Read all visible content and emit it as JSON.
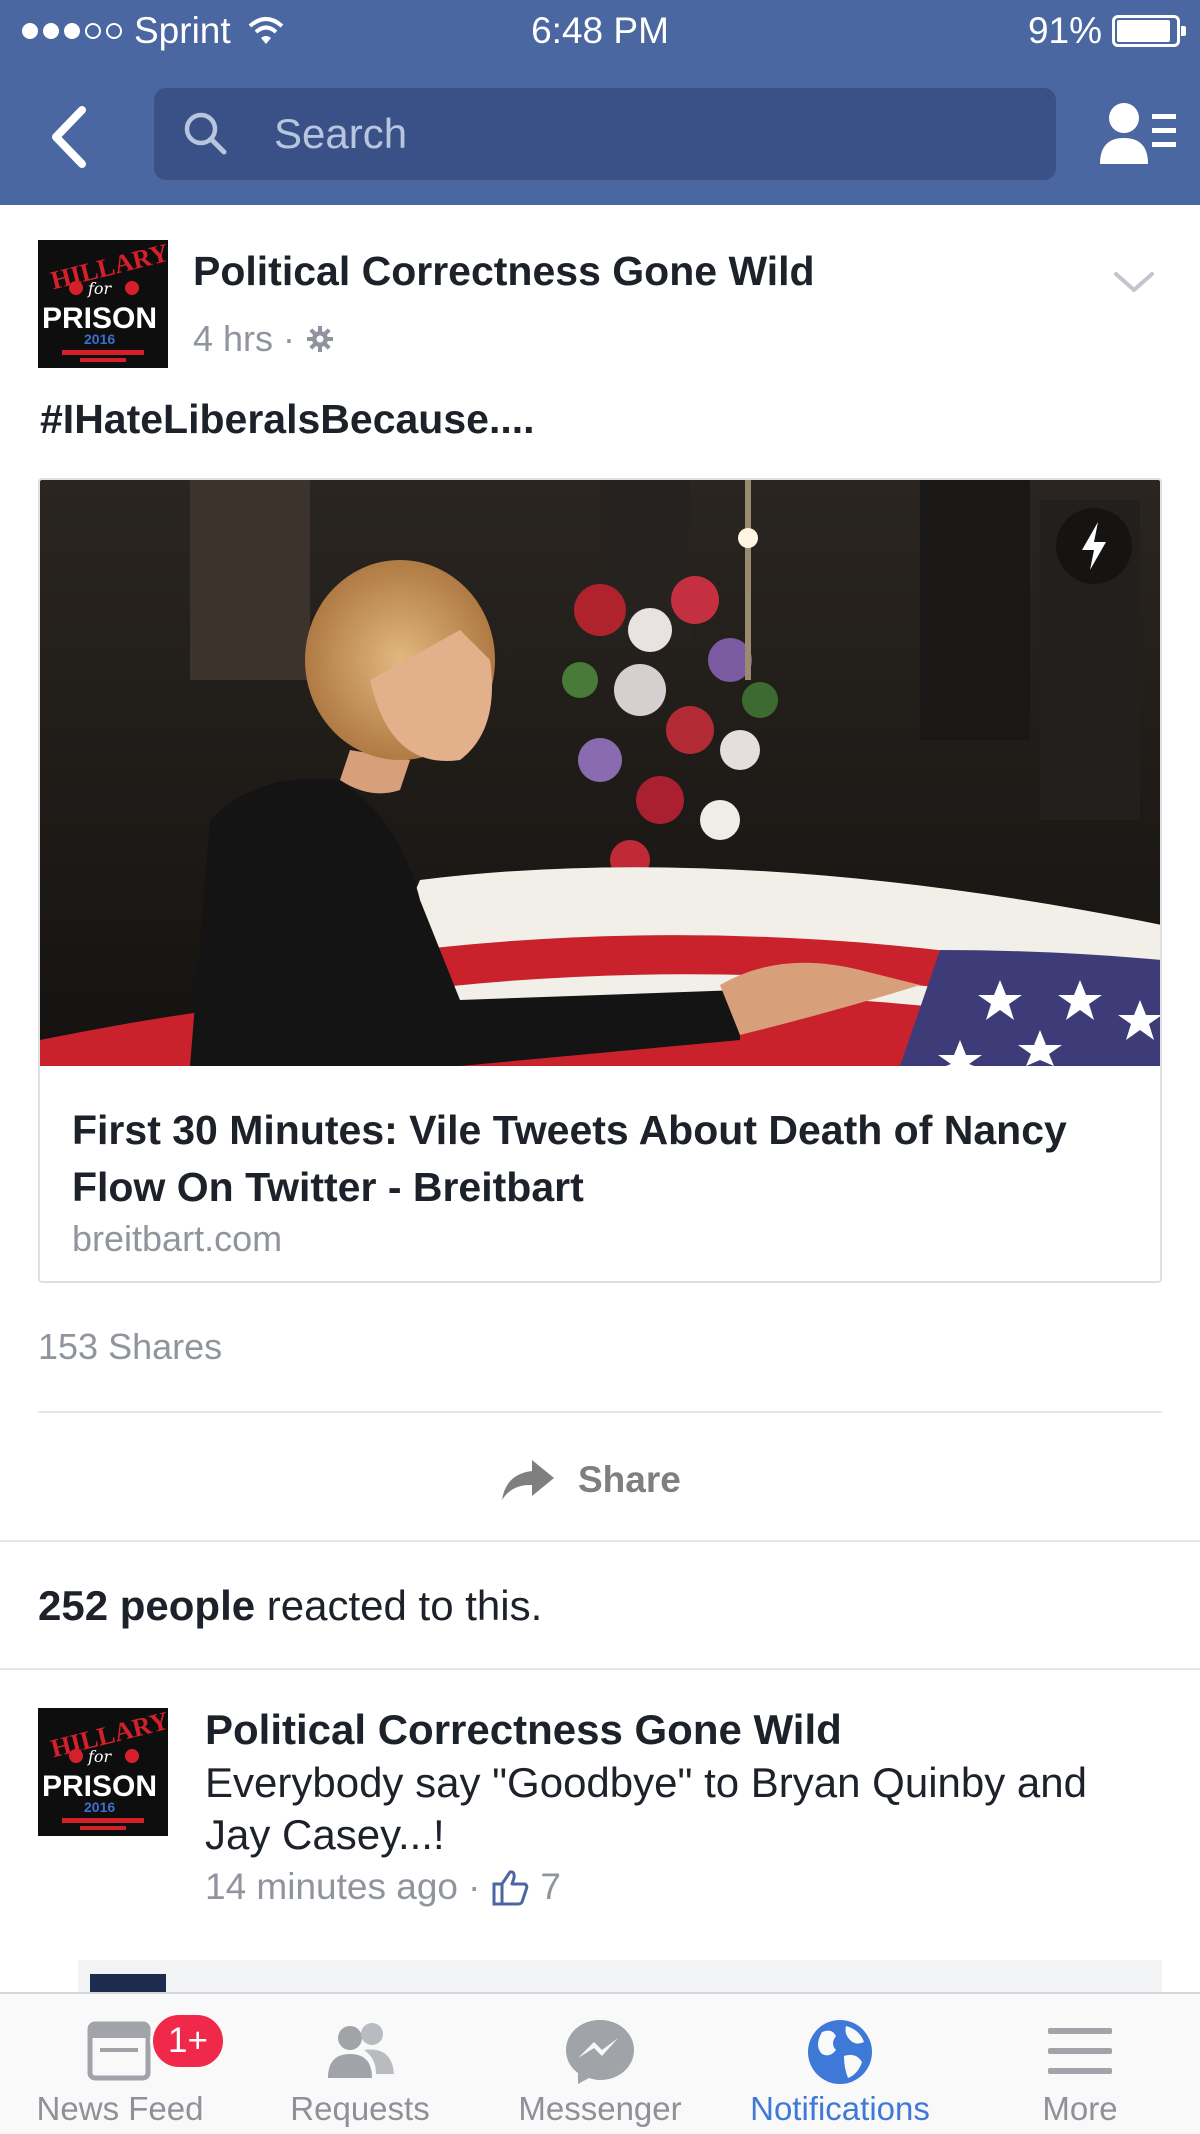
{
  "status_bar": {
    "carrier": "Sprint",
    "time": "6:48 PM",
    "battery_percent": "91%",
    "battery_level": 0.91,
    "signal_bars_filled": 3,
    "signal_bars_total": 5
  },
  "nav": {
    "search_placeholder": "Search"
  },
  "post": {
    "page_name": "Political Correctness Gone Wild",
    "time": "4 hrs",
    "meta_separator": "·",
    "text": "#IHateLiberalsBecause....",
    "link": {
      "title": "First 30 Minutes: Vile Tweets About Death of Nancy Flow On Twitter - Breitbart",
      "domain": "breitbart.com"
    },
    "shares": "153 Shares",
    "share_label": "Share",
    "reactions": {
      "count_text": "252 people",
      "suffix": " reacted to this."
    }
  },
  "comment": {
    "author": "Political Correctness Gone Wild",
    "text": "Everybody say \"Goodbye\" to Bryan Quinby and Jay Casey...!",
    "time": "14 minutes ago",
    "separator": "·",
    "likes": "7"
  },
  "tabbar": {
    "tabs": [
      {
        "label": "News Feed",
        "icon": "news-feed-icon",
        "badge": "1+"
      },
      {
        "label": "Requests",
        "icon": "requests-icon"
      },
      {
        "label": "Messenger",
        "icon": "messenger-icon"
      },
      {
        "label": "Notifications",
        "icon": "globe-icon",
        "active": true
      },
      {
        "label": "More",
        "icon": "menu-icon"
      }
    ]
  },
  "colors": {
    "brand_blue": "#4b67a1",
    "search_bg": "#3a5187",
    "active_tab": "#3f79d8",
    "badge_red": "#f02849"
  }
}
